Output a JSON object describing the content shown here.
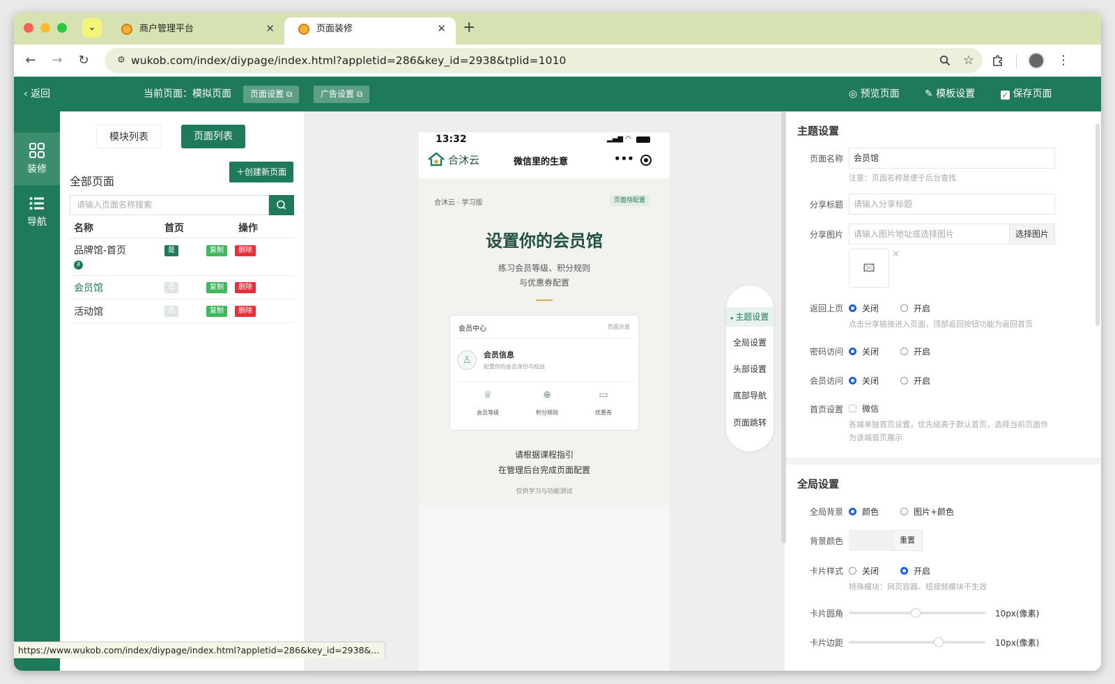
{
  "browser": {
    "tabs": [
      {
        "title": "商户管理平台",
        "close": "✕"
      },
      {
        "title": "页面装修",
        "close": "✕"
      }
    ],
    "new_tab": "+",
    "dropdown_icon": "⌄",
    "url": "wukob.com/index/diypage/index.html?appletid=286&key_id=2938&tplid=1010",
    "nav": {
      "back": "←",
      "forward": "→",
      "reload": "↻"
    },
    "status_url": "https://www.wukob.com/index/diypage/index.html?appletid=286&key_id=2938&..."
  },
  "header": {
    "back": "返回",
    "current_page_label": "当前页面：模拟页面",
    "page_settings": "页面设置",
    "ad_settings": "广告设置",
    "preview": "预览页面",
    "template_settings": "模板设置",
    "save_page": "保存页面"
  },
  "sidebar": {
    "items": [
      {
        "label": "装修"
      },
      {
        "label": "导航"
      }
    ]
  },
  "pagelist": {
    "tabs": [
      "模块列表",
      "页面列表"
    ],
    "title": "全部页面",
    "create": "创建新页面",
    "search_placeholder": "请输入页面名称搜索",
    "columns": [
      "名称",
      "首页",
      "操作"
    ],
    "rows": [
      {
        "name": "品牌馆-首页",
        "home": "是",
        "copy": "复制",
        "delete": "删除"
      },
      {
        "name": "会员馆",
        "home": "否",
        "copy": "复制",
        "delete": "删除"
      },
      {
        "name": "活动馆",
        "home": "否",
        "copy": "复制",
        "delete": "删除"
      }
    ]
  },
  "phone": {
    "time": "13:32",
    "brand": "合沐云",
    "slogan": "微信里的生意",
    "crumb": "合沐云 · 学习版",
    "badge": "页面待配置",
    "heading": "设置你的会员馆",
    "sub1": "练习会员等级、积分规则",
    "sub2": "与优惠券配置",
    "card_title": "会员中心",
    "card_tag": "页面示意",
    "info_title": "会员信息",
    "info_sub": "配置你的会员身份与权益",
    "icons": [
      "会员等级",
      "积分规则",
      "优惠券"
    ],
    "guide1": "请根据课程指引",
    "guide2": "在管理后台完成页面配置",
    "note": "仅供学习与功能测试"
  },
  "sidemenu": [
    "主题设置",
    "全局设置",
    "头部设置",
    "底部导航",
    "页面跳转"
  ],
  "theme": {
    "title": "主题设置",
    "page_name_label": "页面名称",
    "page_name_value": "会员馆",
    "page_name_hint": "注意：页面名称是便于后台查找",
    "share_title_label": "分享标题",
    "share_title_placeholder": "请输入分享标题",
    "share_image_label": "分享图片",
    "share_image_placeholder": "请输入图片地址或选择图片",
    "choose_image": "选择图片",
    "back_label": "返回上页",
    "off": "关闭",
    "on": "开启",
    "back_hint": "点击分享链接进入页面，顶部返回按钮功能为返回首页",
    "pwd_label": "密码访问",
    "member_label": "会员访问",
    "home_label": "首页设置",
    "wechat": "微信",
    "home_hint1": "各端单独首页设置，优先级高于默认首页，选择当前页面作",
    "home_hint2": "为该端首页展示"
  },
  "global": {
    "title": "全局设置",
    "bg_label": "全局背景",
    "color": "颜色",
    "img_color": "图片+颜色",
    "bgcolor_label": "背景颜色",
    "reset": "重置",
    "card_label": "卡片样式",
    "off": "关闭",
    "on": "开启",
    "card_hint": "特殊模块：网页容器、短视频模块不生效",
    "radius_label": "卡片圆角",
    "radius_value": "10px(像素)",
    "margin_label": "卡片边距",
    "margin_value": "10px(像素)",
    "radius_level": 0.49,
    "margin_level": 0.67
  },
  "colors": {
    "primary": "#1f7a5a",
    "copy": "#3fb85f",
    "delete": "#e8303a"
  }
}
